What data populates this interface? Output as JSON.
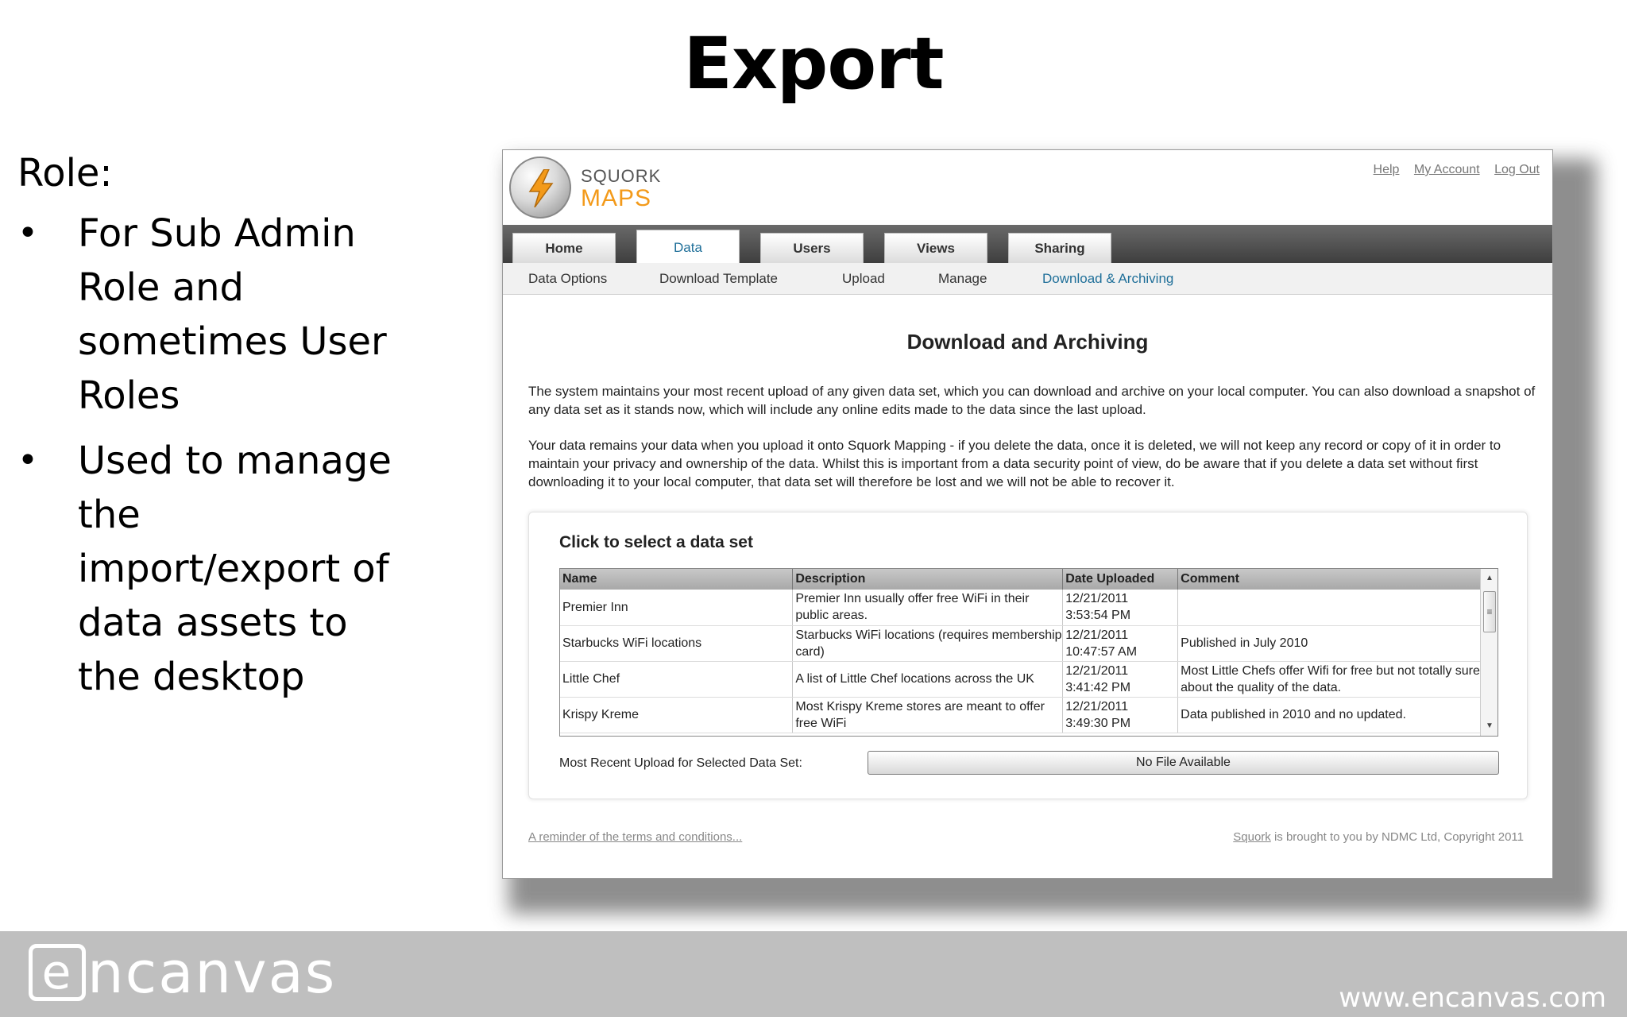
{
  "slide": {
    "title": "Export",
    "role_label": "Role:",
    "bullets": [
      "For Sub Admin Role and sometimes User Roles",
      "Used to manage the import/export of data assets to the desktop"
    ],
    "bullet_glyph": "•",
    "footer_logo_mark": "e",
    "footer_logo_text": "ncanvas",
    "footer_url": "www.encanvas.com"
  },
  "app": {
    "logo_line1": "SQUORK",
    "logo_line2": "MAPS",
    "top_links": [
      "Help",
      "My Account",
      "Log Out"
    ],
    "tabs": [
      {
        "label": "Home",
        "active": false
      },
      {
        "label": "Data",
        "active": true
      },
      {
        "label": "Users",
        "active": false
      },
      {
        "label": "Views",
        "active": false
      },
      {
        "label": "Sharing",
        "active": false
      }
    ],
    "subnav": [
      {
        "label": "Data Options",
        "active": false
      },
      {
        "label": "Download Template",
        "active": false
      },
      {
        "label": "Upload",
        "active": false
      },
      {
        "label": "Manage",
        "active": false
      },
      {
        "label": "Download & Archiving",
        "active": true
      }
    ],
    "page_title": "Download and Archiving",
    "para1": "The system maintains your most recent upload of any given data set, which you can download and archive on your local computer. You can also download a snapshot of any data set as it stands now, which will include any online edits made to the data since the last upload.",
    "para2": "Your data remains your data when you upload it onto Squork Mapping - if you delete the data, once it is deleted, we will not keep any record or copy of it in order to maintain your privacy and ownership of the data. Whilst this is important from a data security point of view, do be aware that if you delete a data set without first downloading it to your local computer, that data set will therefore be lost and we will not be able to recover it.",
    "panel_title": "Click to select a data set",
    "columns": [
      "Name",
      "Description",
      "Date Uploaded",
      "Comment"
    ],
    "rows": [
      {
        "name": "Premier Inn",
        "description": "Premier Inn usually offer free WiFi in their public areas.",
        "date": "12/21/2011",
        "time": "3:53:54 PM",
        "comment": ""
      },
      {
        "name": "Starbucks WiFi locations",
        "description": "Starbucks WiFi locations (requires membership card)",
        "date": "12/21/2011",
        "time": "10:47:57 AM",
        "comment": "Published in July 2010"
      },
      {
        "name": "Little Chef",
        "description": "A list of Little Chef locations across the UK",
        "date": "12/21/2011",
        "time": "3:41:42 PM",
        "comment": "Most Little Chefs offer Wifi for free but not totally sure about the quality of the data."
      },
      {
        "name": "Krispy Kreme",
        "description": "Most Krispy Kreme stores are meant to offer free WiFi",
        "date": "12/21/2011",
        "time": "3:49:30 PM",
        "comment": "Data published in 2010 and no updated."
      }
    ],
    "recent_label": "Most Recent Upload for Selected Data Set:",
    "no_file_label": "No File Available",
    "terms_link": "A reminder of the terms and conditions...",
    "copyright_link": "Squork",
    "copyright_text": " is brought to you by NDMC Ltd, Copyright 2011",
    "colors": {
      "accent_blue": "#1f6f99",
      "logo_orange": "#f39a1a",
      "footer_gray": "#bfbfbf"
    },
    "icons": [
      "bolt-logo-icon",
      "scroll-up-icon",
      "scroll-down-icon",
      "scroll-thumb-grip-icon"
    ]
  }
}
